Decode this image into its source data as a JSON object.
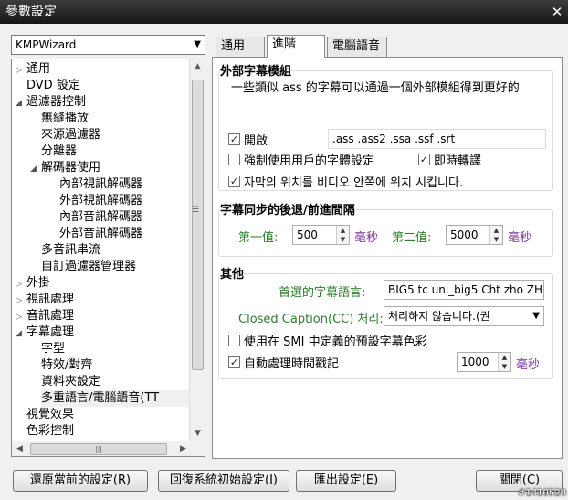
{
  "window": {
    "title": "參數設定",
    "close_glyph": "✕"
  },
  "wizard": {
    "selected": "KMPWizard"
  },
  "tree": {
    "items": [
      {
        "label": "通用",
        "exp": "▷"
      },
      {
        "label": "DVD 設定",
        "exp": ""
      },
      {
        "label": "過濾器控制",
        "exp": "◢"
      },
      {
        "label": "無縫播放",
        "exp": ""
      },
      {
        "label": "來源過濾器",
        "exp": ""
      },
      {
        "label": "分離器",
        "exp": ""
      },
      {
        "label": "解碼器使用",
        "exp": "◢"
      },
      {
        "label": "內部視訊解碼器",
        "exp": ""
      },
      {
        "label": "外部視訊解碼器",
        "exp": ""
      },
      {
        "label": "內部音訊解碼器",
        "exp": ""
      },
      {
        "label": "外部音訊解碼器",
        "exp": ""
      },
      {
        "label": "多音訊串流",
        "exp": ""
      },
      {
        "label": "自訂過濾器管理器",
        "exp": ""
      },
      {
        "label": "外掛",
        "exp": "▷"
      },
      {
        "label": "視訊處理",
        "exp": "▷"
      },
      {
        "label": "音訊處理",
        "exp": "▷"
      },
      {
        "label": "字幕處理",
        "exp": "◢"
      },
      {
        "label": "字型",
        "exp": ""
      },
      {
        "label": "特效/對齊",
        "exp": ""
      },
      {
        "label": "資料夾設定",
        "exp": ""
      },
      {
        "label": "多重語言/電腦語音(TT",
        "exp": ""
      },
      {
        "label": "視覺效果",
        "exp": ""
      },
      {
        "label": "色彩控制",
        "exp": ""
      }
    ]
  },
  "tabs": [
    {
      "label": "通用"
    },
    {
      "label": "進階"
    },
    {
      "label": "電腦語音"
    }
  ],
  "external": {
    "title": "外部字幕模組",
    "desc": "一些類似 ass 的字幕可以通過一個外部模組得到更好的",
    "enable_label": "開啟",
    "enable_checked": "✓",
    "exts": ".ass .ass2 .ssa .ssf .srt",
    "force_font_label": "強制使用用戶的字體設定",
    "force_font_checked": "",
    "realtime_label": "即時轉譯",
    "realtime_checked": "✓",
    "korean_label": "자막의 위치를 비디오 안쪽에 위치 시킵니다.",
    "korean_checked": "✓"
  },
  "sync": {
    "title": "字幕同步的後退/前進間隔",
    "first_label": "第一值:",
    "first_value": "500",
    "unit1": "毫秒",
    "second_label": "第二值:",
    "second_value": "5000",
    "unit2": "毫秒"
  },
  "other": {
    "title": "其他",
    "lang_label": "首選的字幕語言:",
    "lang_value": "BIG5 tc uni_big5 Cht zho ZH",
    "cc_label": "Closed Caption(CC) 처리:",
    "cc_value": "처리하지 않습니다.(권",
    "smi_label": "使用在 SMI 中定義的預設字幕色彩",
    "smi_checked": "",
    "auto_label": "自動處理時間戳記",
    "auto_checked": "✓",
    "auto_value": "1000",
    "auto_unit": "毫秒"
  },
  "buttons": {
    "restore": "還原當前的設定(R)",
    "reset": "回復系統初始設定(I)",
    "export": "匯出設定(E)",
    "close": "關閉(C)"
  },
  "watermark": "#1410520"
}
